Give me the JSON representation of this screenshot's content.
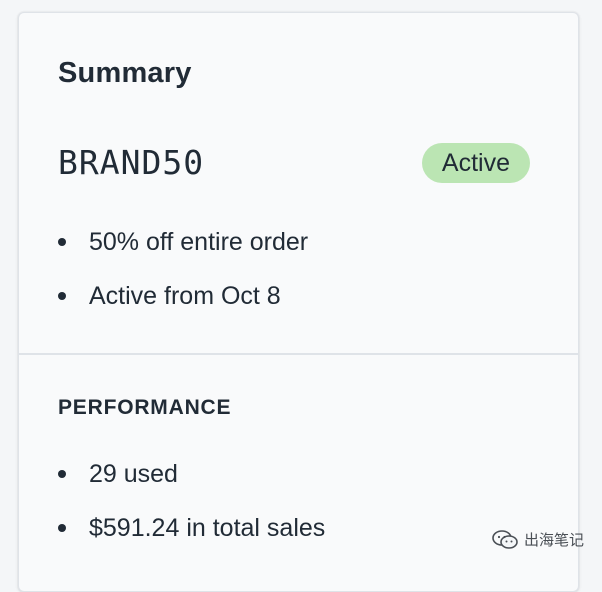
{
  "summary": {
    "title": "Summary",
    "discount_code": "BRAND50",
    "status": "Active",
    "status_color": "#bbe5b3",
    "details": [
      "50% off entire order",
      "Active from Oct 8"
    ]
  },
  "performance": {
    "heading": "PERFORMANCE",
    "items": [
      "29 used",
      "$591.24 in total sales"
    ]
  },
  "watermark": {
    "icon": "wechat-icon",
    "text": "出海笔记"
  }
}
